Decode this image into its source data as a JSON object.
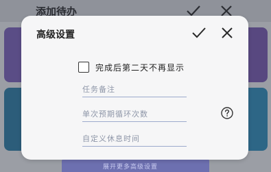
{
  "background": {
    "title": "添加待办",
    "footer_text": "展开更多高级设置"
  },
  "dialog": {
    "title": "高级设置",
    "checkbox_label": "完成后第二天不再显示",
    "checkbox_checked": false,
    "fields": [
      {
        "placeholder": "任务备注",
        "value": ""
      },
      {
        "placeholder": "单次预期循环次数",
        "value": ""
      },
      {
        "placeholder": "自定义休息时间",
        "value": ""
      }
    ]
  },
  "icons": {
    "confirm": "check-icon",
    "close": "close-icon",
    "help": "question-circle-icon"
  }
}
